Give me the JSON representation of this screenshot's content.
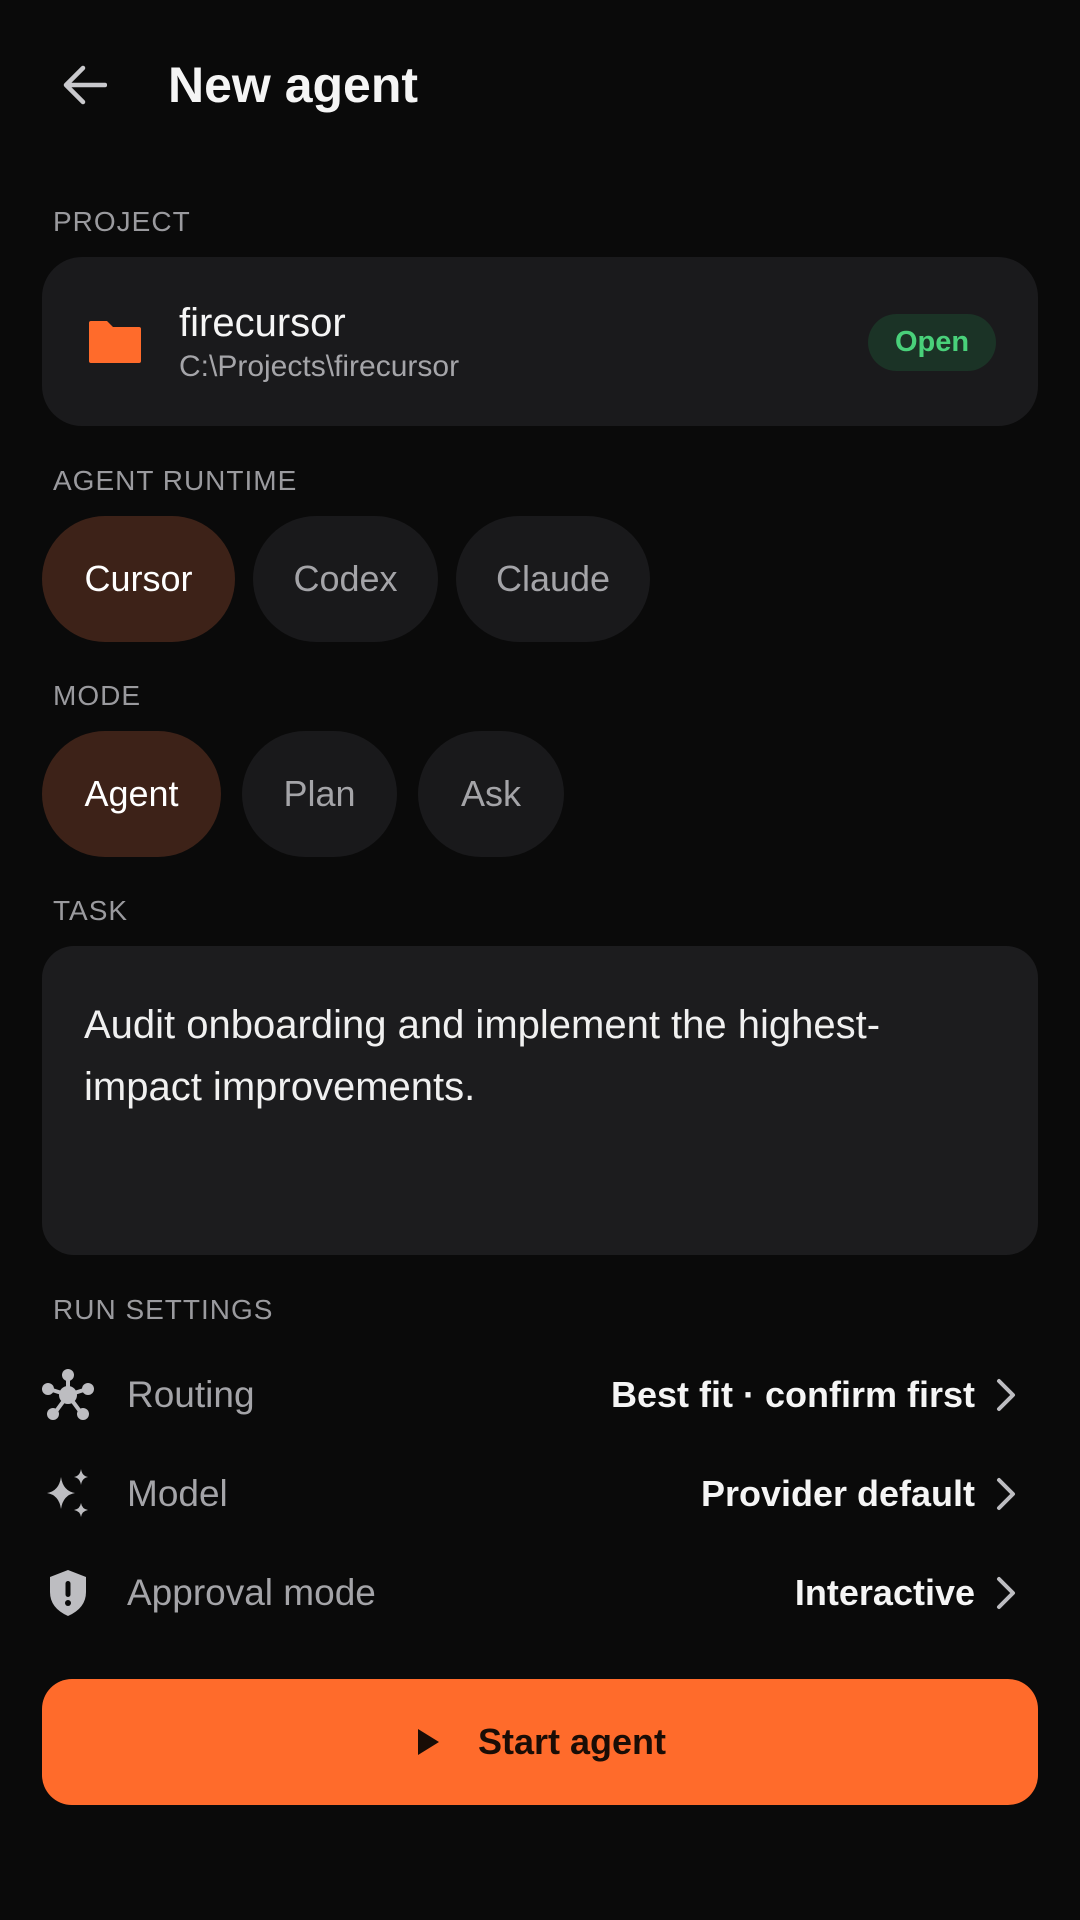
{
  "header": {
    "title": "New agent",
    "back_icon": "arrow-left-icon"
  },
  "project": {
    "section_label": "PROJECT",
    "name": "firecursor",
    "path": "C:\\Projects\\firecursor",
    "badge": "Open",
    "icon": "folder-icon",
    "icon_color": "#ff6b2b",
    "badge_color": "#49d17a"
  },
  "runtime": {
    "section_label": "AGENT RUNTIME",
    "options": [
      "Cursor",
      "Codex",
      "Claude"
    ],
    "selected": "Cursor"
  },
  "mode": {
    "section_label": "MODE",
    "options": [
      "Agent",
      "Plan",
      "Ask"
    ],
    "selected": "Agent"
  },
  "task": {
    "section_label": "TASK",
    "value": "Audit onboarding and implement the highest-impact improvements."
  },
  "run_settings": {
    "section_label": "RUN SETTINGS",
    "items": [
      {
        "label": "Routing",
        "value": "Best fit · confirm first",
        "icon": "routing-hub-icon"
      },
      {
        "label": "Model",
        "value": "Provider default",
        "icon": "sparkles-icon"
      },
      {
        "label": "Approval mode",
        "value": "Interactive",
        "icon": "shield-alert-icon"
      }
    ]
  },
  "primary_action": {
    "label": "Start agent",
    "icon": "play-icon",
    "color": "#ff6b2b"
  }
}
